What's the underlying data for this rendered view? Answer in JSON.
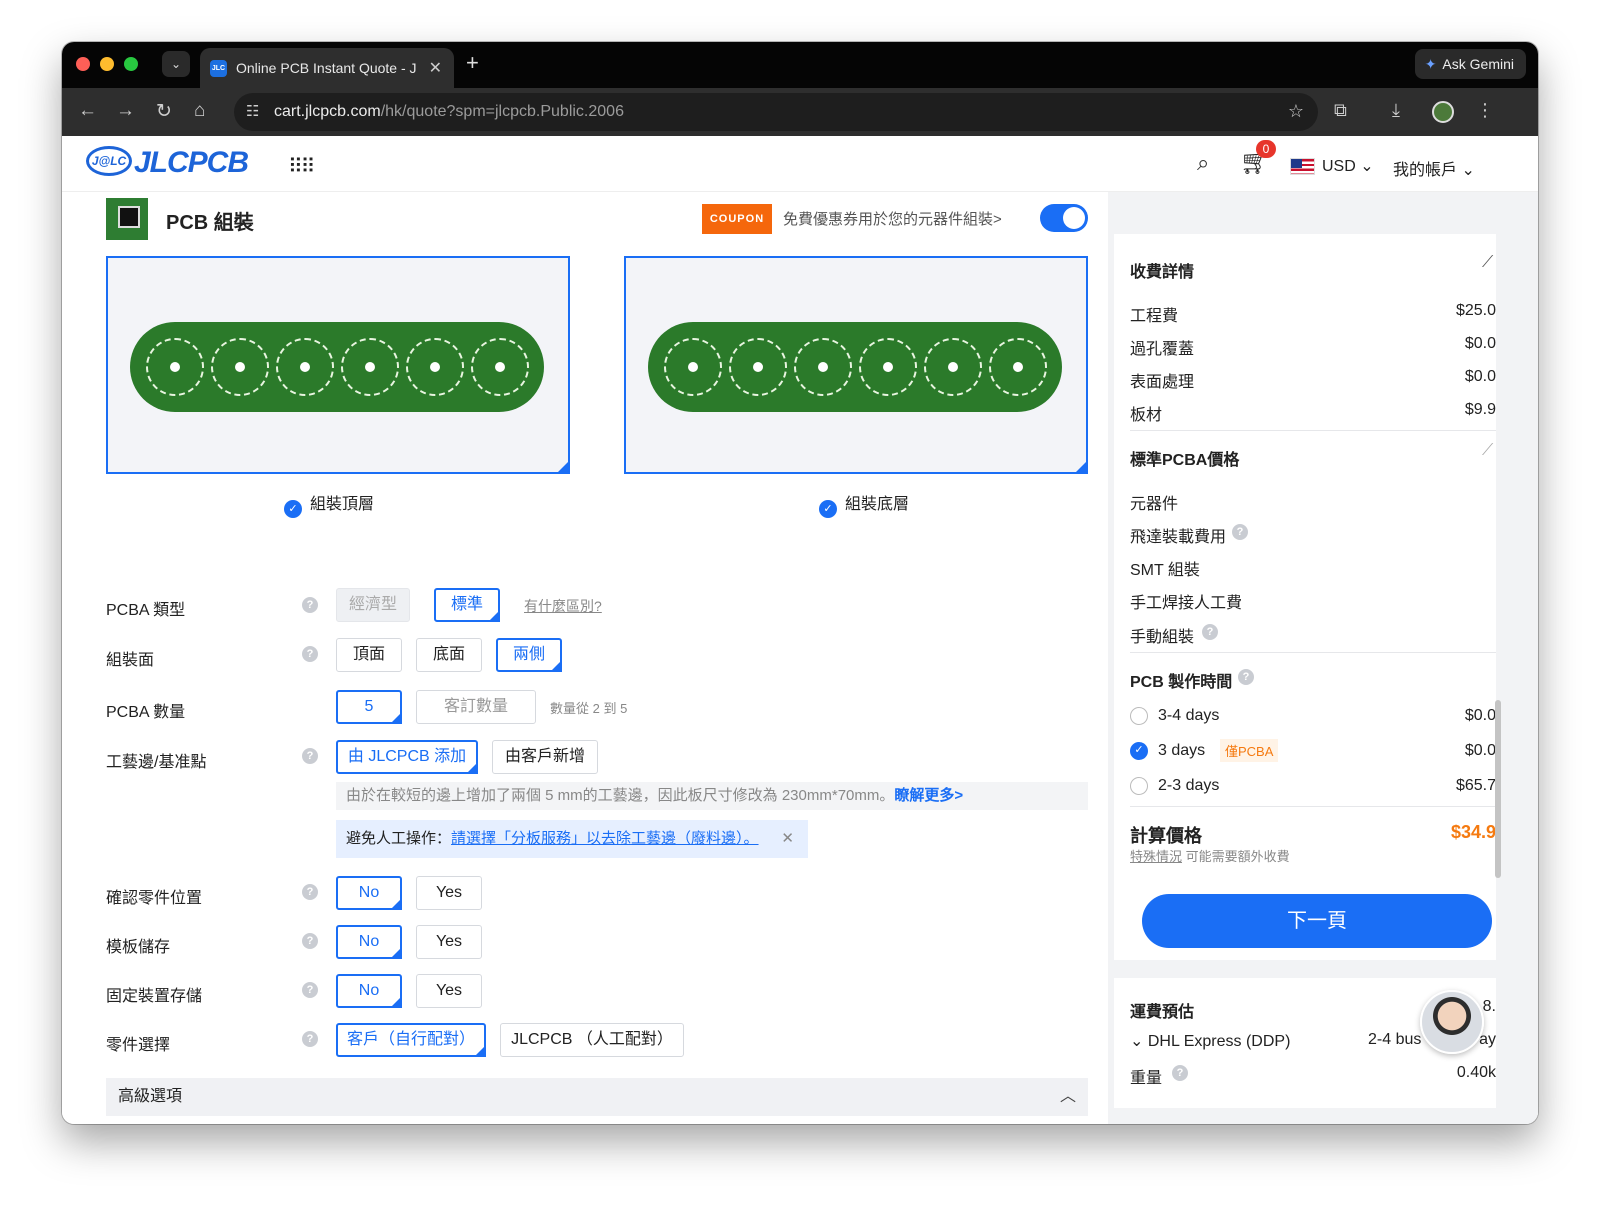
{
  "browser": {
    "tab_title": "Online PCB Instant Quote - JL",
    "tab_close": "✕",
    "new_tab": "+",
    "ask_gemini": "Ask Gemini",
    "url_host": "cart.jlcpcb.com",
    "url_path": "/hk/quote?spm=jlcpcb.Public.2006"
  },
  "site": {
    "logo_text": "JLCPCB",
    "logo_mark": "J@LC",
    "cart_count": "0",
    "currency": "USD ⌄",
    "account": "我的帳戶 ⌄"
  },
  "section": {
    "title": "PCB 組裝",
    "coupon_badge": "COUPON",
    "coupon_text": "免費優惠券用於您的元器件組裝>",
    "top_layer": "組裝頂層",
    "bottom_layer": "組裝底層"
  },
  "form": {
    "pcba_type_label": "PCBA 類型",
    "pcba_type_economic": "經濟型",
    "pcba_type_standard": "標準",
    "pcba_type_diff": "有什麼區別?",
    "side_label": "組裝面",
    "side_top": "頂面",
    "side_bottom": "底面",
    "side_both": "兩側",
    "qty_label": "PCBA 數量",
    "qty_value": "5",
    "qty_custom": "客訂數量",
    "qty_hint": "數量從 2 到 5",
    "rail_label": "工藝邊/基准點",
    "rail_jlc": "由 JLCPCB 添加",
    "rail_customer": "由客戶新增",
    "rail_info": "由於在較短的邊上增加了兩個 5 mm的工藝邊，因此板尺寸修改為 230mm*70mm。",
    "rail_more": "瞭解更多>",
    "notice_prefix": "避免人工操作：",
    "notice_link": "請選擇「分板服務」以去除工藝邊（廢料邊）。",
    "notice_close": "✕",
    "confirm_label": "確認零件位置",
    "stencil_label": "模板儲存",
    "fixture_label": "固定裝置存儲",
    "no": "No",
    "yes": "Yes",
    "parts_label": "零件選擇",
    "parts_customer": "客戶（自行配對）",
    "parts_jlc": "JLCPCB （人工配對）",
    "advanced": "高級選項"
  },
  "charges": {
    "title": "收費詳情",
    "items": [
      {
        "label": "工程費",
        "value": "$25.0"
      },
      {
        "label": "過孔覆蓋",
        "value": "$0.0"
      },
      {
        "label": "表面處理",
        "value": "$0.0"
      },
      {
        "label": "板材",
        "value": "$9.9"
      }
    ],
    "pcba_title": "標準PCBA價格",
    "pcba_items": [
      "元器件",
      "飛達裝載費用",
      "SMT 組裝",
      "手工焊接人工費",
      "手動組裝"
    ],
    "build_title": "PCB 製作時間",
    "build_options": [
      {
        "label": "3-4 days",
        "value": "$0.0",
        "selected": false
      },
      {
        "label": "3 days",
        "value": "$0.0",
        "selected": true,
        "tag": "僅PCBA"
      },
      {
        "label": "2-3 days",
        "value": "$65.7",
        "selected": false
      }
    ],
    "calc_title": "計算價格",
    "calc_value": "$34.9",
    "calc_note_link": "特殊情況",
    "calc_note": "可能需要額外收費",
    "next": "下一頁"
  },
  "shipping": {
    "title": "運費預估",
    "title_value": "8.",
    "method": "DHL Express (DDP)",
    "method_eta": "2-4 bus",
    "method_eta_tail": "ay",
    "weight_label": "重量",
    "weight_value": "0.40k"
  },
  "colors": {
    "accent": "#1a6ef5",
    "price": "#f57a10",
    "pcb_green": "#2b7a2a",
    "coupon": "#f5670c"
  }
}
